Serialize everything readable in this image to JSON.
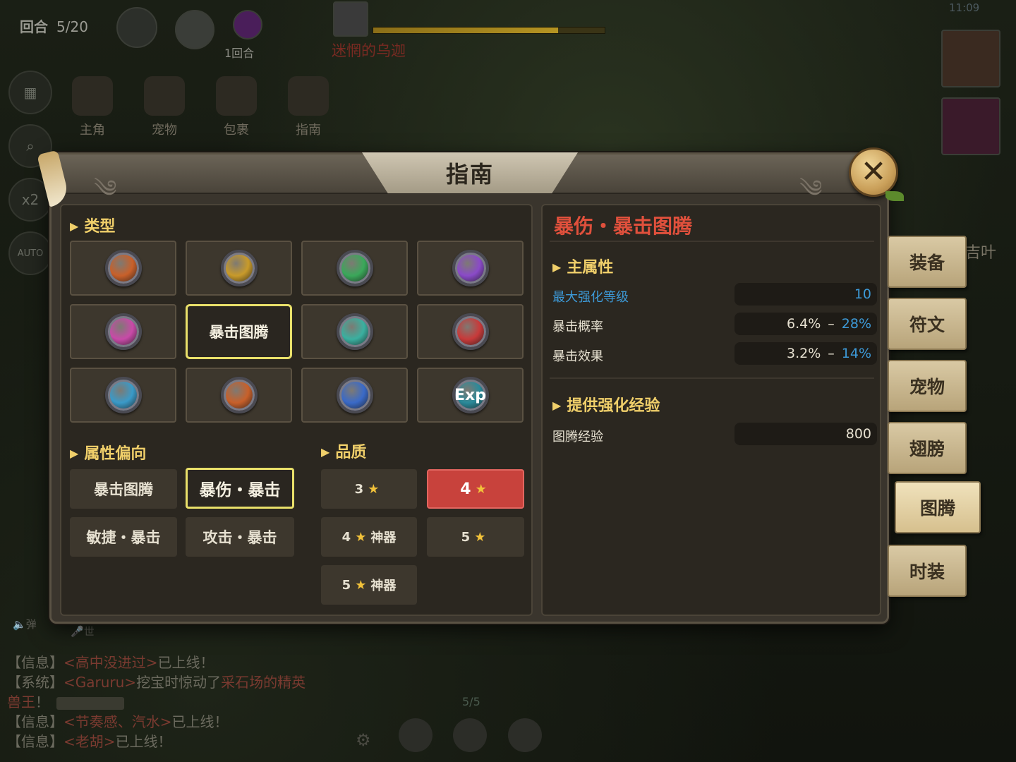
{
  "hud": {
    "round_label": "回合",
    "round_value": "5/20",
    "round_sub": "1回合",
    "boss_name": "迷惘的乌迦",
    "boss_hp_fraction": 0.8,
    "time": "11:09",
    "speed": "x2",
    "auto": "AUTO"
  },
  "top_nav": [
    {
      "label": "主角"
    },
    {
      "label": "宠物"
    },
    {
      "label": "包裹"
    },
    {
      "label": "指南"
    }
  ],
  "modal": {
    "title": "指南",
    "left": {
      "type_label": "类型",
      "type_cells": [
        {
          "icon": "sword-gem-icon",
          "color": "#c8602a"
        },
        {
          "icon": "shield-gem-icon",
          "color": "#c89a2a"
        },
        {
          "icon": "heart-gem-icon",
          "color": "#3aa85a"
        },
        {
          "icon": "spiral-gem-icon",
          "color": "#8a4ac8"
        },
        {
          "icon": "triple-spiral-gem-icon",
          "color": "#c84aa8"
        },
        {
          "selected_label": "暴击图腾"
        },
        {
          "icon": "leaf-gem-icon",
          "color": "#3ab0a0"
        },
        {
          "icon": "wing-gem-icon",
          "color": "#c83a3a"
        },
        {
          "icon": "wind-gem-icon",
          "color": "#3a9ac8"
        },
        {
          "icon": "target-gem-icon",
          "color": "#c8602a"
        },
        {
          "icon": "fist-gem-icon",
          "color": "#3a6ac8"
        },
        {
          "icon": "exp-gem-icon",
          "color": "#2a8a9a",
          "text": "Exp"
        }
      ],
      "bias_label": "属性偏向",
      "bias_options": [
        "暴击图腾",
        "暴伤・暴击",
        "敏捷・暴击",
        "攻击・暴击"
      ],
      "quality_label": "品质",
      "quality_options": [
        {
          "num": "3",
          "suffix": ""
        },
        {
          "num": "4",
          "suffix": ""
        },
        {
          "num": "4",
          "suffix": "神器"
        },
        {
          "num": "5",
          "suffix": ""
        },
        {
          "num": "5",
          "suffix": "神器"
        }
      ]
    },
    "right": {
      "item_name": "暴伤・暴击图腾",
      "main_attr_label": "主属性",
      "stats": [
        {
          "label": "最大强化等级",
          "value": "10"
        },
        {
          "label": "暴击概率",
          "min": "6.4%",
          "max": "28%"
        },
        {
          "label": "暴击效果",
          "min": "3.2%",
          "max": "14%"
        }
      ],
      "exp_label": "提供强化经验",
      "exp_stat": {
        "label": "图腾经验",
        "value": "800"
      }
    },
    "side_tabs": [
      "装备",
      "符文",
      "宠物",
      "翅膀",
      "图腾",
      "时装"
    ],
    "active_tab": "图腾"
  },
  "chat": [
    {
      "tag": "【信息】",
      "nick": "<高中没进过>",
      "text": "已上线！"
    },
    {
      "tag": "【系统】",
      "nick": "<Garuru>",
      "text": "挖宝时惊动了",
      "hl": "采石场的精英"
    },
    {
      "tag": "",
      "nick": "",
      "hl": "兽王",
      "text": "！"
    },
    {
      "tag": "【信息】",
      "nick": "<节奏感、汽水>",
      "text": "已上线！"
    },
    {
      "tag": "【信息】",
      "nick": "<老胡>",
      "text": "已上线！"
    }
  ],
  "chat_controls": {
    "toggle_label": "弹",
    "channel_label": "世"
  },
  "page_indicator": "5/5",
  "partial_text": {
    "right_name": "吉叶"
  }
}
